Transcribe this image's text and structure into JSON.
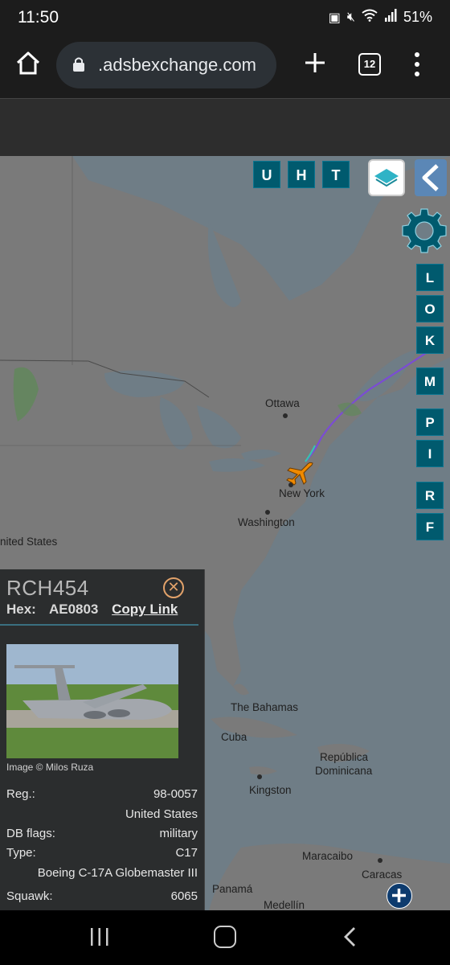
{
  "status": {
    "time": "11:50",
    "battery": "51%",
    "icons": [
      "sim-icon",
      "mute-icon",
      "wifi-icon",
      "signal-icon"
    ]
  },
  "browser": {
    "url": ".adsbexchange.com",
    "tab_count": "12",
    "icons": [
      "home-icon",
      "lock-icon",
      "plus-icon",
      "tabs-icon",
      "more-vert-icon"
    ]
  },
  "map": {
    "labels": {
      "ottawa": "Ottawa",
      "new_york": "New York",
      "washington": "Washington",
      "united_states": "nited States",
      "bahamas": "The Bahamas",
      "cuba": "Cuba",
      "republica": "República",
      "dominicana": "Dominicana",
      "kingston": "Kingston",
      "maracaibo": "Maracaibo",
      "caracas": "Caracas",
      "panama": "Panamá",
      "medellin": "Medellín"
    },
    "top_buttons": [
      "U",
      "H",
      "T"
    ],
    "side_buttons": [
      "L",
      "O",
      "K",
      "M",
      "P",
      "I",
      "R",
      "F"
    ],
    "colors": {
      "water": "#6f7d86",
      "land": "#7c7c7c",
      "button": "#005a6e",
      "aircraft": "#f08a00"
    }
  },
  "aircraft": {
    "callsign": "RCH454",
    "hex_label": "Hex:",
    "hex": "AE0803",
    "copy_link": "Copy Link",
    "image_credit": "Image © Milos Ruza",
    "fields": [
      {
        "key": "Reg.:",
        "value": "98-0057"
      },
      {
        "key": "",
        "value": "United States"
      },
      {
        "key": "DB flags:",
        "value": "military"
      },
      {
        "key": "Type:",
        "value": "C17"
      },
      {
        "key": "",
        "value": "Boeing C-17A Globemaster III"
      },
      {
        "key": "Squawk:",
        "value": "6065"
      }
    ]
  },
  "navbar": {
    "icons": [
      "recents-icon",
      "home-nav-icon",
      "back-nav-icon"
    ]
  }
}
